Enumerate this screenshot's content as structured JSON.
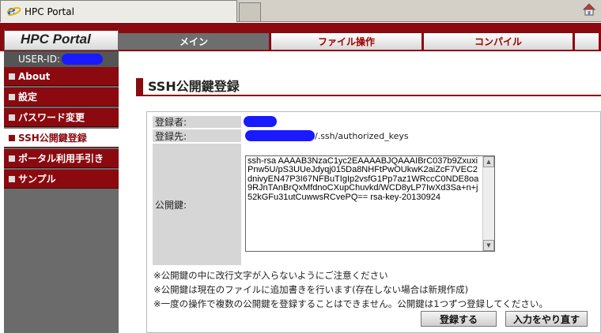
{
  "browser": {
    "tab_title": "HPC Portal"
  },
  "portal": {
    "logo": "HPC Portal",
    "nav": [
      {
        "label": "メイン"
      },
      {
        "label": "ファイル操作"
      },
      {
        "label": "コンパイル"
      }
    ],
    "user_label": "USER-ID:"
  },
  "sidebar": {
    "items": [
      {
        "label": "About"
      },
      {
        "label": "設定"
      },
      {
        "label": "パスワード変更"
      },
      {
        "label": "SSH公開鍵登録"
      },
      {
        "label": "ポータル利用手引き"
      },
      {
        "label": "サンプル"
      }
    ]
  },
  "main": {
    "title": "SSH公開鍵登録",
    "registrant_label": "登録者:",
    "destination_label": "登録先:",
    "destination_suffix": "/.ssh/authorized_keys",
    "pubkey_label": "公開鍵:",
    "pubkey_value": "ssh-rsa AAAAB3NzaC1yc2EAAAABJQAAAIBrC037b9ZxuxiPnw5U/pS3UUeJdyqj015Da8NHFtPwOUkwK2aiZcF7VEC2dnivyEN47P3I67NFBuTIgIp2vsfG1Pp7az1WRccC0NDE8oa9RJnTAnBrQxMfdnoCXupChuvkd/WCD8yLP7IwXd3Sa+n+j52kGFu31utCuwwsRCvePQ== rsa-key-20130924",
    "notes": [
      "※公開鍵の中に改行文字が入らないようにご注意ください",
      "※公開鍵は現在のファイルに追加書きを行います(存在しない場合は新規作成)",
      "※一度の操作で複数の公開鍵を登録することはできません。公開鍵は1つずつ登録してください。"
    ],
    "submit_label": "登録する",
    "reset_label": "入力をやり直す"
  },
  "colors": {
    "brand": "#8a0a10",
    "redaction": "#1a1aff"
  }
}
